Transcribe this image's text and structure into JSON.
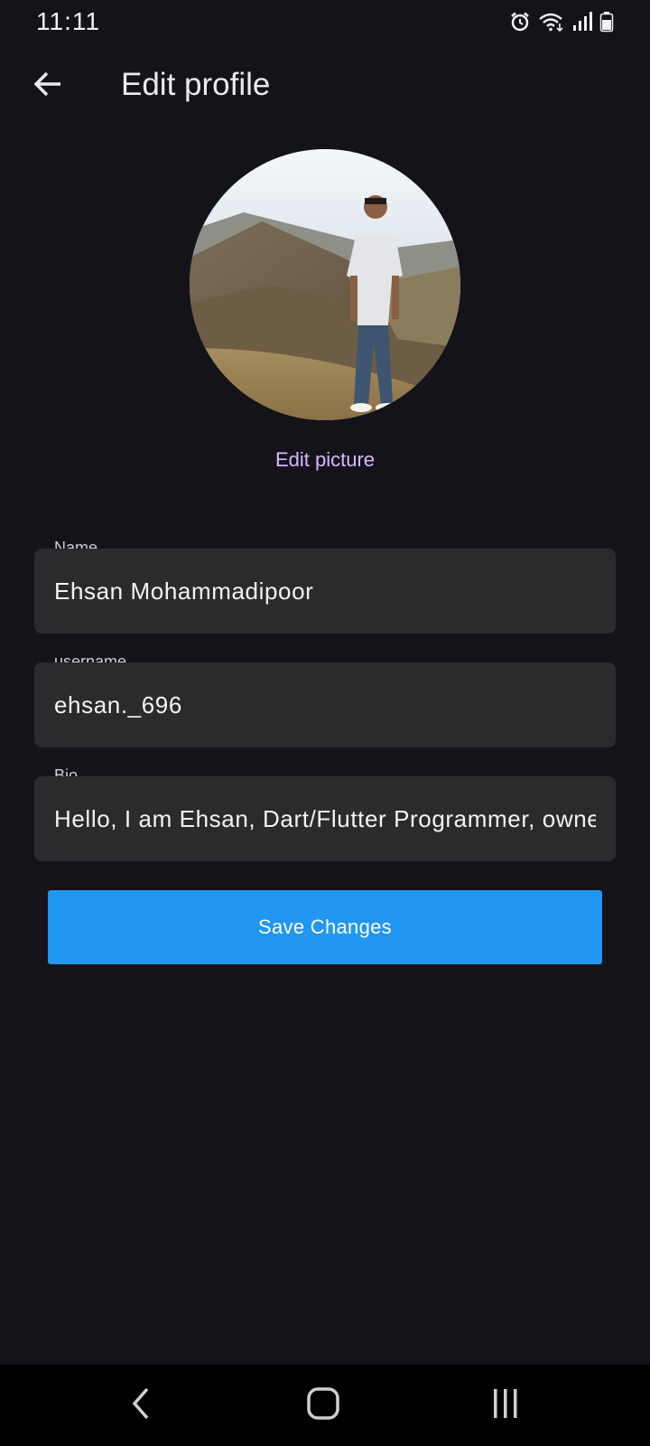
{
  "status_bar": {
    "time": "11:11",
    "icons": [
      "alarm-icon",
      "wifi-icon",
      "signal-icon",
      "battery-icon"
    ]
  },
  "header": {
    "title": "Edit profile",
    "back_icon": "arrow-back-icon"
  },
  "profile": {
    "edit_picture_label": "Edit picture"
  },
  "form": {
    "name": {
      "label": "Name",
      "value": "Ehsan Mohammadipoor"
    },
    "username": {
      "label": "username",
      "value": "ehsan._696"
    },
    "bio": {
      "label": "Bio",
      "value": "Hello, I am Ehsan, Dart/Flutter Programmer, owner of this account"
    }
  },
  "actions": {
    "save_label": "Save Changes"
  },
  "nav": {
    "items": [
      "back-nav-icon",
      "home-nav-icon",
      "recents-nav-icon"
    ]
  },
  "colors": {
    "background": "#15131a",
    "field_background": "#2b2b2d",
    "accent_link": "#d5baff",
    "primary_button": "#2196f3"
  }
}
